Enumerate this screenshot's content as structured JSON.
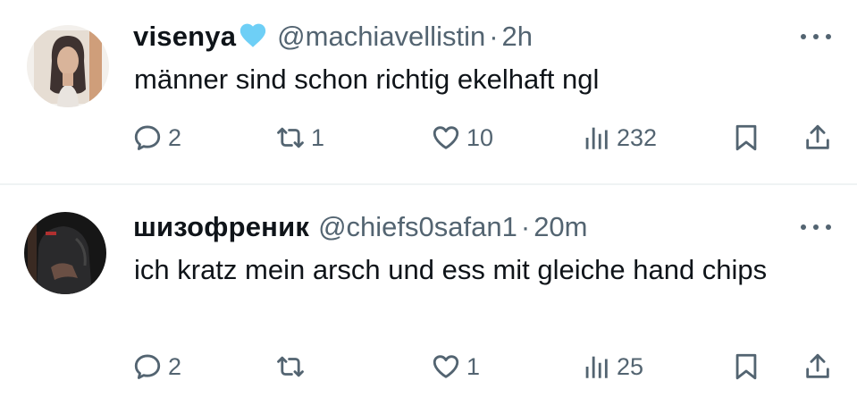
{
  "tweets": [
    {
      "display_name": "visenya",
      "handle": "@machiavellistin",
      "separator": "·",
      "time": "2h",
      "text": "männer sind schon richtig ekelhaft ngl",
      "badge_icon": "light-blue-heart-icon",
      "badge_color": "#6ecff6",
      "stats": {
        "replies": "2",
        "retweets": "1",
        "likes": "10",
        "views": "232"
      }
    },
    {
      "display_name": "шизофреник",
      "handle": "@chiefs0safan1",
      "separator": "·",
      "time": "20m",
      "text": "ich kratz mein arsch und ess mit gleiche hand chips",
      "stats": {
        "replies": "2",
        "retweets": "",
        "likes": "1",
        "views": "25"
      }
    }
  ],
  "icons": {
    "more": "more-dots-icon",
    "reply": "reply-bubble-icon",
    "retweet": "retweet-icon",
    "like": "heart-outline-icon",
    "views": "views-bars-icon",
    "bookmark": "bookmark-icon",
    "share": "share-upload-icon"
  },
  "colors": {
    "text": "#0f1419",
    "secondary": "#536471",
    "divider": "#eff3f4",
    "background": "#ffffff"
  }
}
